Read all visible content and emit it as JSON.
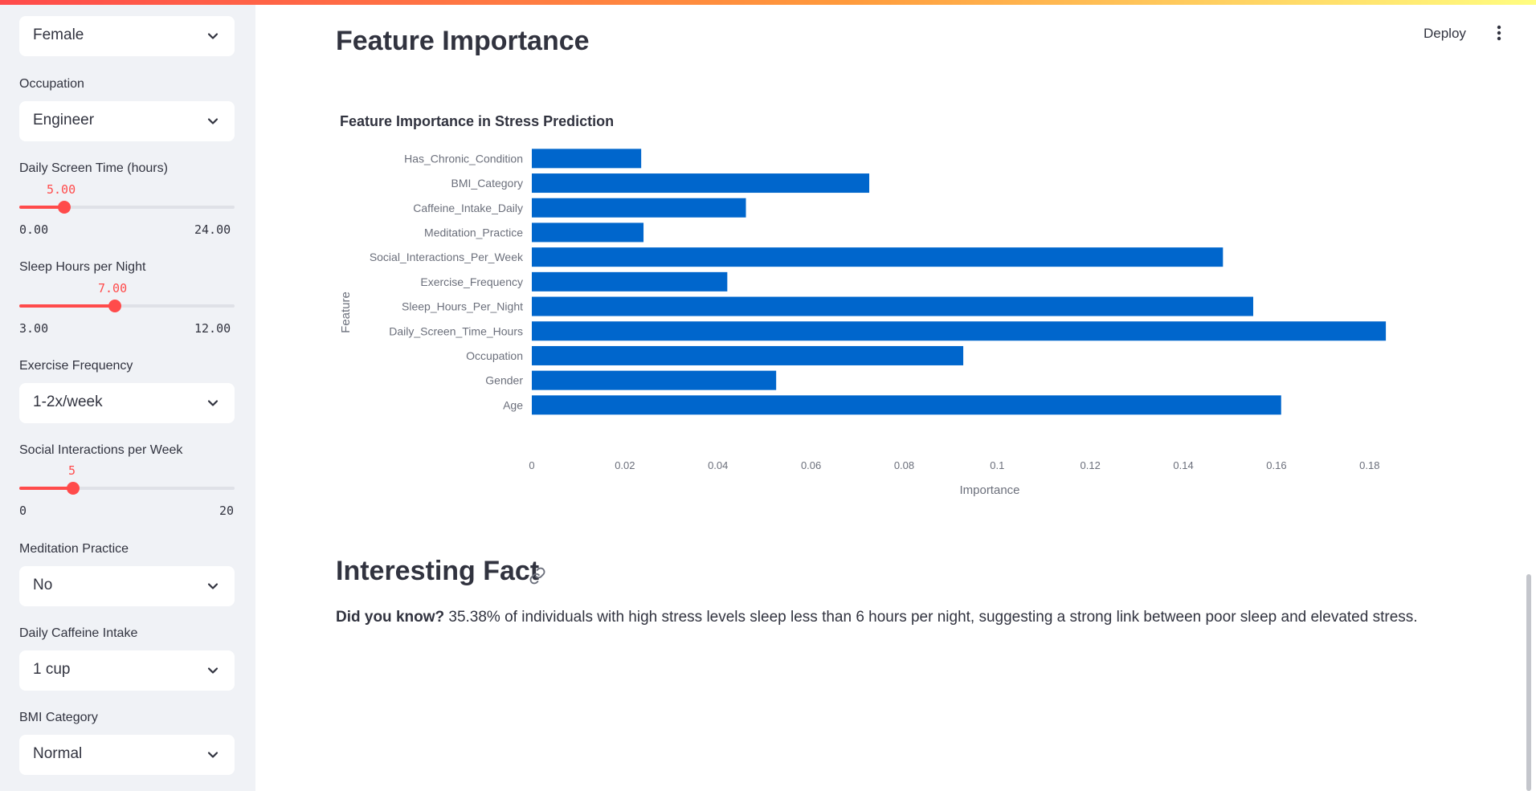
{
  "sidebar": {
    "gender_value": "Female",
    "occupation": {
      "label": "Occupation",
      "value": "Engineer"
    },
    "screen_time": {
      "label": "Daily Screen Time (hours)",
      "value": "5.00",
      "min": "0.00",
      "max": "24.00",
      "level": 0.2083
    },
    "sleep_hours": {
      "label": "Sleep Hours per Night",
      "value": "7.00",
      "min": "3.00",
      "max": "12.00",
      "level": 0.4444
    },
    "exercise": {
      "label": "Exercise Frequency",
      "value": "1-2x/week"
    },
    "social": {
      "label": "Social Interactions per Week",
      "value": "5",
      "min": "0",
      "max": "20",
      "level": 0.25
    },
    "meditation": {
      "label": "Meditation Practice",
      "value": "No"
    },
    "caffeine": {
      "label": "Daily Caffeine Intake",
      "value": "1 cup"
    },
    "bmi": {
      "label": "BMI Category",
      "value": "Normal"
    }
  },
  "header": {
    "title": "Feature Importance",
    "deploy_label": "Deploy"
  },
  "chart_data": {
    "type": "bar",
    "orientation": "horizontal",
    "title": "Feature Importance in Stress Prediction",
    "xlabel": "Importance",
    "ylabel": "Feature",
    "xlim": [
      0,
      0.184
    ],
    "xticks": [
      "0",
      "0.02",
      "0.04",
      "0.06",
      "0.08",
      "0.1",
      "0.12",
      "0.14",
      "0.16",
      "0.18"
    ],
    "categories": [
      "Has_Chronic_Condition",
      "BMI_Category",
      "Caffeine_Intake_Daily",
      "Meditation_Practice",
      "Social_Interactions_Per_Week",
      "Exercise_Frequency",
      "Sleep_Hours_Per_Night",
      "Daily_Screen_Time_Hours",
      "Occupation",
      "Gender",
      "Age"
    ],
    "values": [
      0.0235,
      0.0725,
      0.046,
      0.024,
      0.1485,
      0.042,
      0.155,
      0.1835,
      0.0927,
      0.0525,
      0.161
    ],
    "bar_color": "#0066cc",
    "grid": false
  },
  "fact_section": {
    "title": "Interesting Fact",
    "lead": "Did you know?",
    "text": " 35.38% of individuals with high stress levels sleep less than 6 hours per night, suggesting a strong link between poor sleep and elevated stress."
  },
  "colors": {
    "accent": "#ff4b4b",
    "sidebar_bg": "#f0f2f6",
    "bar": "#0066cc"
  }
}
